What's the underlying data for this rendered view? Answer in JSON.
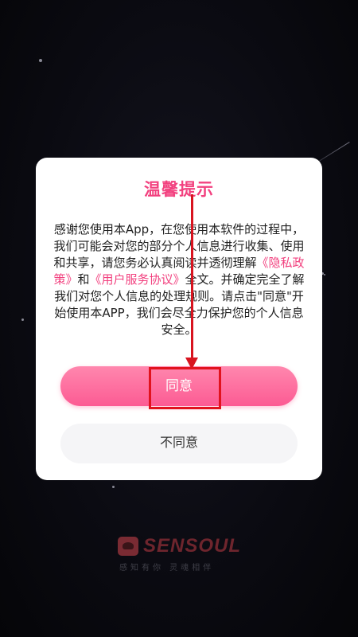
{
  "dialog": {
    "title": "温馨提示",
    "body_part1": "感谢您使用本App，在您使用本软件的过程中，我们可能会对您的部分个人信息进行收集、使用和共享，请您务必认真阅读并透彻理解",
    "privacy_link": "《隐私政策》",
    "body_and": "和",
    "service_link": "《用户服务协议》",
    "body_part2": "全文。并确定完全了解我们对您个人信息的处理规则。请点击\"同意\"开始使用本APP，我们会尽全力保护您的个人信息安全。",
    "agree_label": "同意",
    "disagree_label": "不同意"
  },
  "brand": {
    "name": "SENSOUL",
    "slogan": "感知有你 灵魂相伴"
  },
  "colors": {
    "accent": "#f2417f",
    "annotation": "#e1121d"
  }
}
